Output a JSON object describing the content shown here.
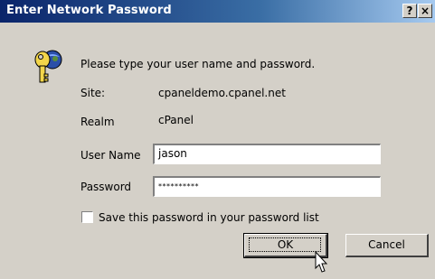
{
  "window": {
    "title": "Enter Network Password",
    "help_label": "?",
    "close_label": "×"
  },
  "dialog": {
    "prompt": "Please type your user name and password.",
    "site_label": "Site:",
    "site_value": "cpaneldemo.cpanel.net",
    "realm_label": "Realm",
    "realm_value": "cPanel",
    "username_label": "User Name",
    "username_value": "jason",
    "password_label": "Password",
    "password_value": "**********",
    "save_label": "Save this password in your password list",
    "ok_label": "OK",
    "cancel_label": "Cancel"
  },
  "icons": {
    "dialog": "key-icon",
    "cursor": "mouse-pointer-icon"
  }
}
